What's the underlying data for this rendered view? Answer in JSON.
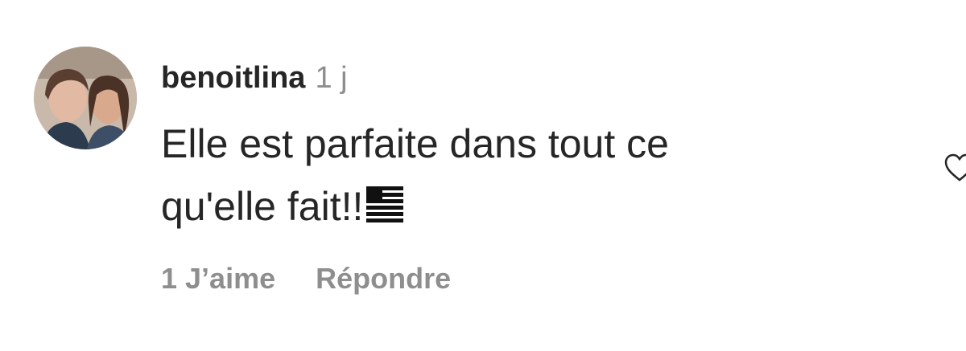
{
  "comment": {
    "username": "benoitlina",
    "time": "1 j",
    "text_line1": "Elle est parfaite dans tout ce",
    "text_line2": "qu'elle fait!!",
    "likes_label": "1 J’aime",
    "reply_label": "Répondre"
  },
  "icons": {
    "avatar": "avatar-photo",
    "flag_emoji": "flag-emoji",
    "like": "heart-icon"
  },
  "colors": {
    "primary_text": "#262626",
    "secondary_text": "#8e8e8e"
  }
}
